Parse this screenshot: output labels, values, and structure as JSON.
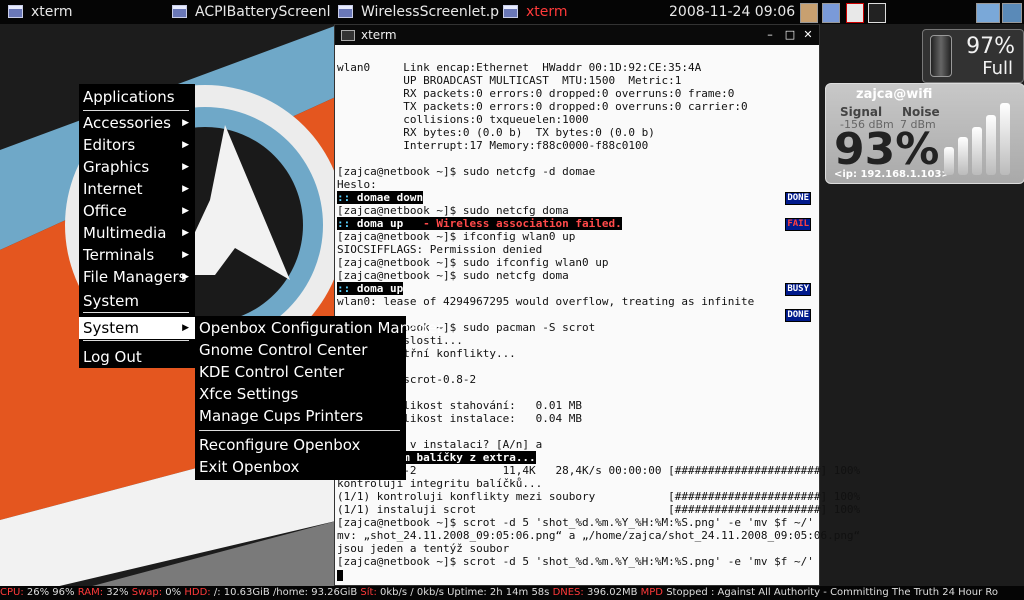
{
  "taskbar": {
    "tasks": [
      {
        "label": "xterm",
        "active": false
      },
      {
        "label": "ACPIBatteryScreenl",
        "active": false
      },
      {
        "label": "WirelessScreenlet.p",
        "active": false
      },
      {
        "label": "xterm",
        "active": true
      }
    ],
    "clock": "2008-11-24 09:06"
  },
  "xterm": {
    "title": "xterm",
    "lines": [
      "wlan0     Link encap:Ethernet  HWaddr 00:1D:92:CE:35:4A",
      "          UP BROADCAST MULTICAST  MTU:1500  Metric:1",
      "          RX packets:0 errors:0 dropped:0 overruns:0 frame:0",
      "          TX packets:0 errors:0 dropped:0 overruns:0 carrier:0",
      "          collisions:0 txqueuelen:1000",
      "          RX bytes:0 (0.0 b)  TX bytes:0 (0.0 b)",
      "          Interrupt:17 Memory:f88c0000-f88c0100",
      "",
      "[zajca@netbook ~]$ sudo netcfg -d domae",
      "Heslo:",
      ":: domae down",
      "[zajca@netbook ~]$ sudo netcfg doma",
      ":: doma up   - Wireless association failed.",
      "[zajca@netbook ~]$ ifconfig wlan0 up",
      "SIOCSIFFLAGS: Permission denied",
      "[zajca@netbook ~]$ sudo ifconfig wlan0 up",
      "[zajca@netbook ~]$ sudo netcfg doma",
      ":: doma up",
      "wlan0: lease of 4294967295 would overflow, treating as infinite",
      "",
      "[zajca@netbook ~]$ sudo pacman -S scrot",
      "Řeším závislosti...",
      "Hledám vnitřní konflikty...",
      "",
      "Cíle (1): scrot-0.8-2",
      "",
      "Celková velikost stahování:   0.01 MB",
      "Celková velikost instalace:   0.04 MB",
      "",
      "Pokračovat v instalaci? [A/n] a",
      ":: Získávám balíčky z extra...",
      " scrot-0.8-2             11,4K   28,4K/s 00:00:00 [######################] 100%",
      "kontroluji integritu balíčků...",
      "(1/1) kontroluji konflikty mezi soubory           [######################] 100%",
      "(1/1) instaluji scrot                             [######################] 100%",
      "[zajca@netbook ~]$ scrot -d 5 'shot_%d.%m.%Y_%H:%M:%S.png' -e 'mv $f ~/'",
      "mv: „shot_24.11.2008_09:05:06.png“ a „/home/zajca/shot_24.11.2008_09:05:06.png“",
      "jsou jeden a tentýž soubor",
      "[zajca@netbook ~]$ scrot -d 5 'shot_%d.%m.%Y_%H:%M:%S.png' -e 'mv $f ~/'"
    ],
    "badges": {
      "done1": "DONE",
      "fail": "FAIL",
      "busy": "BUSY",
      "done2": "DONE"
    }
  },
  "menu": {
    "root": [
      "Applications",
      "Accessories",
      "Editors",
      "Graphics",
      "Internet",
      "Office",
      "Multimedia",
      "Terminals",
      "File Managers",
      "System",
      "System",
      "Log Out"
    ],
    "system": [
      "Openbox Configuration Manager",
      "Gnome Control Center",
      "KDE Control Center",
      "Xfce Settings",
      "Manage Cups Printers",
      "Reconfigure Openbox",
      "Exit Openbox"
    ]
  },
  "battery": {
    "percent": "97%",
    "state": "Full",
    "level": 0.97
  },
  "wifi": {
    "name": "zajca@wifi",
    "signal_label": "Signal",
    "noise_label": "Noise",
    "signal_value": "-156 dBm",
    "noise_value": "7 dBm",
    "quality": "93%",
    "quality_value": 93,
    "ip": "<ip: 192.168.1.103>"
  },
  "status": {
    "cpu_label": "CPU:",
    "cpu": "26% 96%",
    "ram_label": "RAM:",
    "ram": "32%",
    "swap_label": "Swap:",
    "swap": "0%",
    "hdd_label": "HDD:",
    "hdd": "/: 10.63GiB  /home: 93.26GiB",
    "net_label": "Sít:",
    "net": "0kb/s / 0kb/s",
    "uptime": "Uptime: 2h 14m 58s",
    "dnes_label": "DNES:",
    "dnes": "396.02MB",
    "mpd_label": "MPD",
    "mpd": "Stopped :   Against All Authority - Committing The Truth 24 Hour Ro"
  },
  "colors": {
    "accent_red": "#ff3a3a",
    "panel_bg": "#050505",
    "wallpaper_orange": "#e4561f",
    "wallpaper_blue": "#6fa8c8"
  }
}
